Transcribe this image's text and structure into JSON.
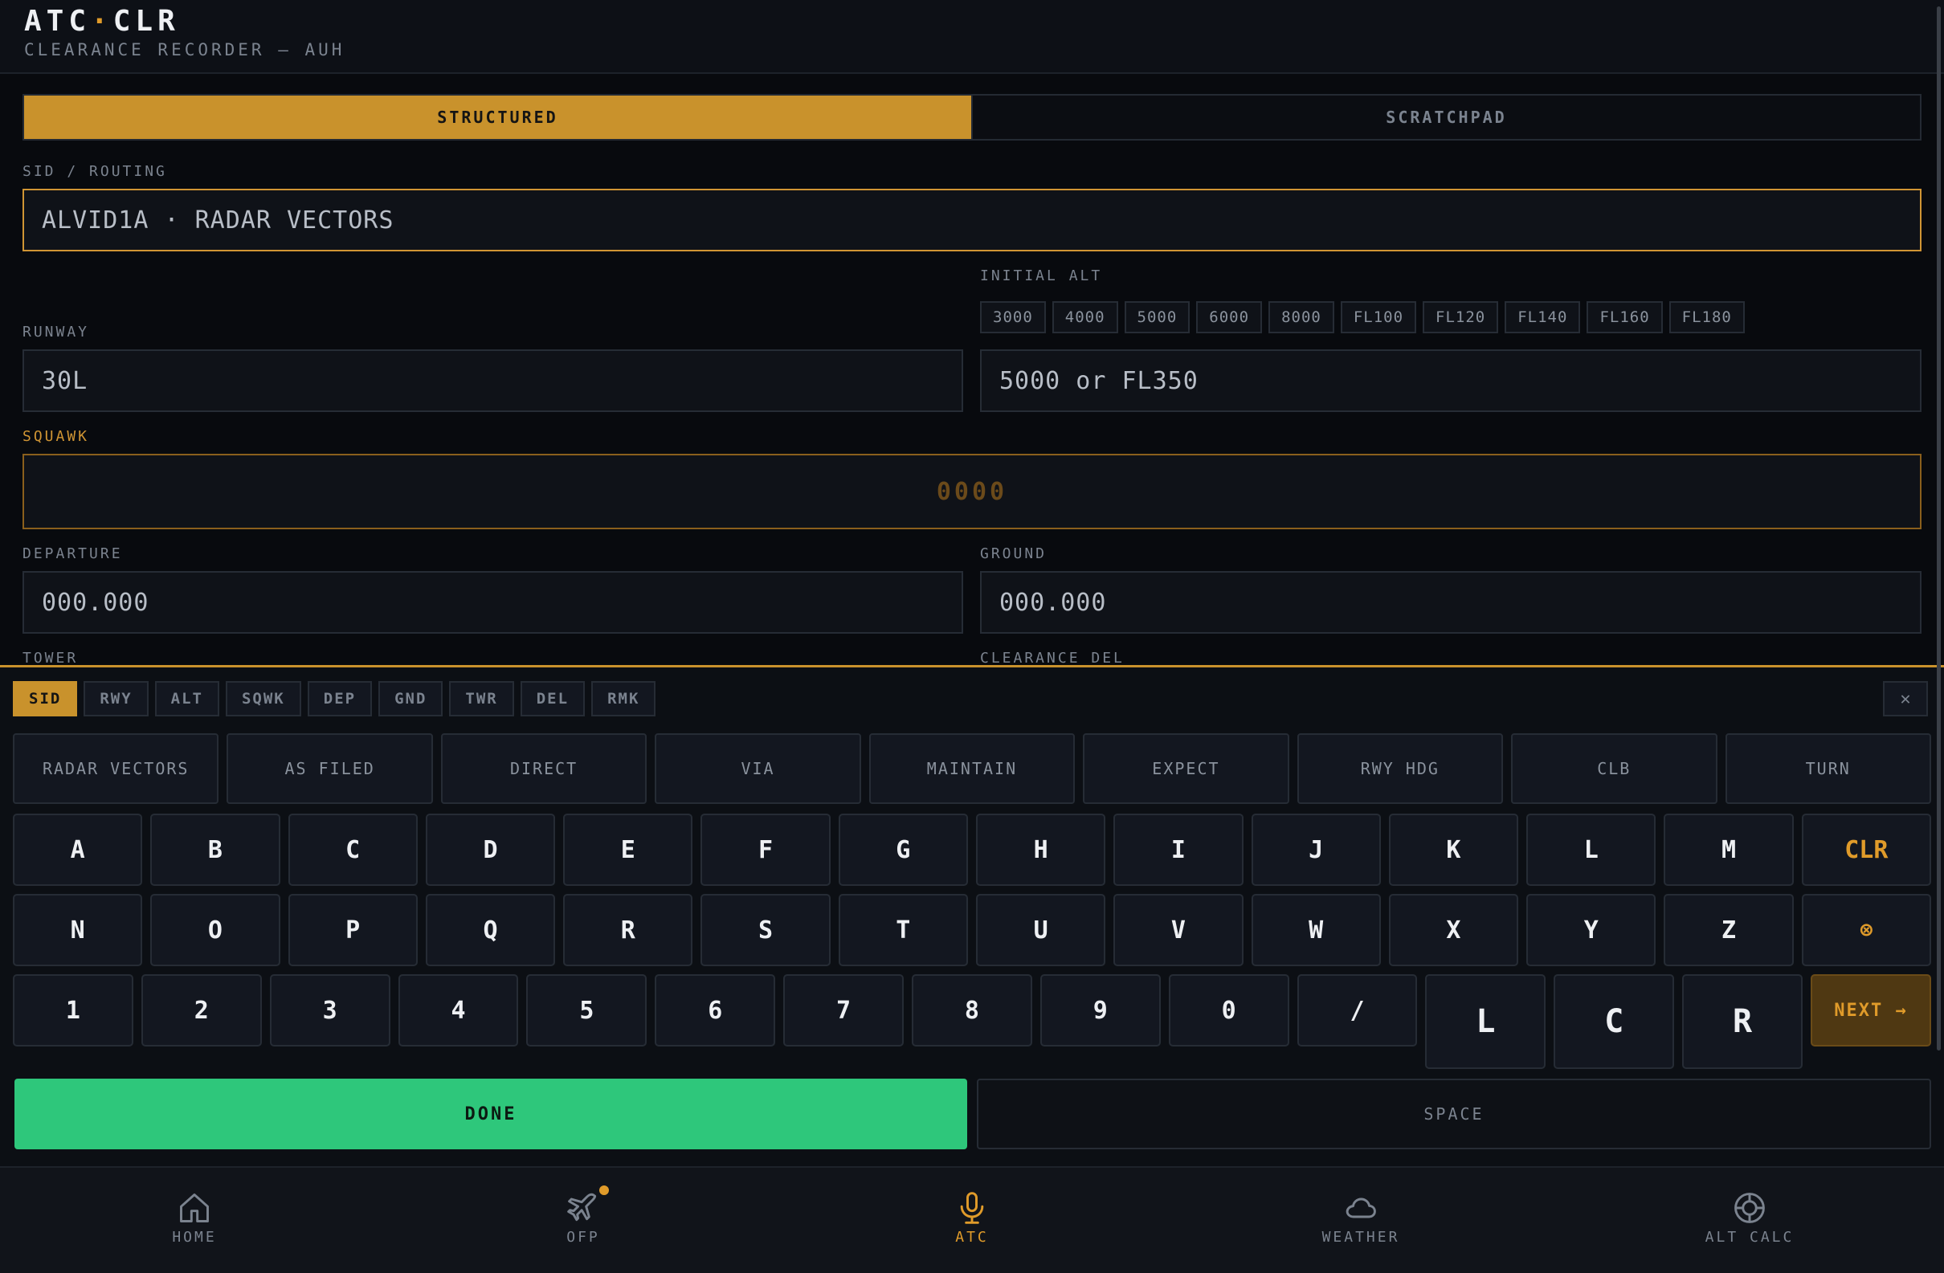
{
  "header": {
    "title_a": "ATC",
    "title_dot": "·",
    "title_b": "CLR",
    "subtitle": "CLEARANCE RECORDER — AUH"
  },
  "tabs": [
    {
      "label": "STRUCTURED",
      "active": true
    },
    {
      "label": "SCRATCHPAD",
      "active": false
    }
  ],
  "form": {
    "sid": {
      "label": "SID / ROUTING",
      "value": "ALVID1A · RADAR VECTORS"
    },
    "runway": {
      "label": "RUNWAY",
      "value": "30L"
    },
    "initial_alt": {
      "label": "INITIAL ALT",
      "placeholder": "5000 or FL350",
      "chips": [
        "3000",
        "4000",
        "5000",
        "6000",
        "8000",
        "FL100",
        "FL120",
        "FL140",
        "FL160",
        "FL180"
      ]
    },
    "squawk": {
      "label": "SQUAWK",
      "placeholder": "0000"
    },
    "departure": {
      "label": "DEPARTURE",
      "placeholder": "000.000"
    },
    "ground": {
      "label": "GROUND",
      "placeholder": "000.000"
    },
    "tower": {
      "label": "TOWER"
    },
    "clearance_del": {
      "label": "CLEARANCE DEL"
    }
  },
  "keyboard": {
    "field_tabs": [
      "SID",
      "RWY",
      "ALT",
      "SQWK",
      "DEP",
      "GND",
      "TWR",
      "DEL",
      "RMK"
    ],
    "active_tab": "SID",
    "close": "✕",
    "phrases": [
      "RADAR VECTORS",
      "AS FILED",
      "DIRECT",
      "VIA",
      "MAINTAIN",
      "EXPECT",
      "RWY HDG",
      "CLB",
      "TURN"
    ],
    "row1": [
      "A",
      "B",
      "C",
      "D",
      "E",
      "F",
      "G",
      "H",
      "I",
      "J",
      "K",
      "L",
      "M"
    ],
    "clr": "CLR",
    "row2": [
      "N",
      "O",
      "P",
      "Q",
      "R",
      "S",
      "T",
      "U",
      "V",
      "W",
      "X",
      "Y",
      "Z"
    ],
    "backspace": "⊗",
    "row3": [
      "1",
      "2",
      "3",
      "4",
      "5",
      "6",
      "7",
      "8",
      "9",
      "0",
      "/"
    ],
    "lcr": [
      "L",
      "C",
      "R"
    ],
    "next": "NEXT →",
    "done": "DONE",
    "space": "SPACE"
  },
  "nav": [
    {
      "label": "HOME",
      "icon": "home-icon",
      "active": false
    },
    {
      "label": "OFP",
      "icon": "plane-icon",
      "active": false,
      "badge": true
    },
    {
      "label": "ATC",
      "icon": "mic-icon",
      "active": true
    },
    {
      "label": "WEATHER",
      "icon": "cloud-icon",
      "active": false
    },
    {
      "label": "ALT CALC",
      "icon": "target-icon",
      "active": false
    }
  ],
  "colors": {
    "accent": "#c9922c",
    "done": "#2ec77b",
    "background": "#080a0e"
  }
}
